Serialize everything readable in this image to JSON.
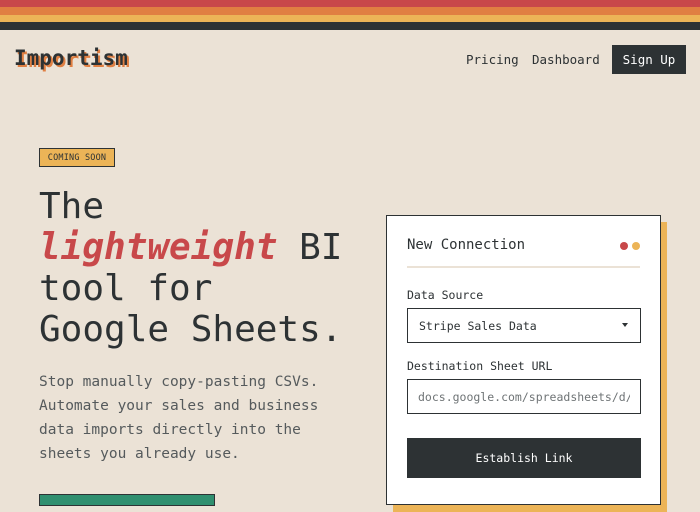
{
  "header": {
    "logo": "Importism",
    "nav": {
      "pricing": "Pricing",
      "dashboard": "Dashboard"
    },
    "signup_label": "Sign Up"
  },
  "hero": {
    "badge": "COMING SOON",
    "headline": {
      "line1": "The",
      "accent": "lightweight",
      "line2_rest": " BI",
      "line3": "tool for",
      "line4": "Google Sheets."
    },
    "subtext": "Stop manually copy-pasting CSVs. Automate your sales and business data imports directly into the sheets you already use."
  },
  "connection_card": {
    "title": "New Connection",
    "data_source_label": "Data Source",
    "data_source_value": "Stripe Sales Data",
    "destination_label": "Destination Sheet URL",
    "destination_placeholder": "docs.google.com/spreadsheets/d/...",
    "submit_label": "Establish Link"
  },
  "colors": {
    "background": "#ebe2d6",
    "dark": "#2d3234",
    "red": "#c8484a",
    "orange": "#e07f42",
    "amber": "#ecb457",
    "green": "#2f8f6f"
  }
}
